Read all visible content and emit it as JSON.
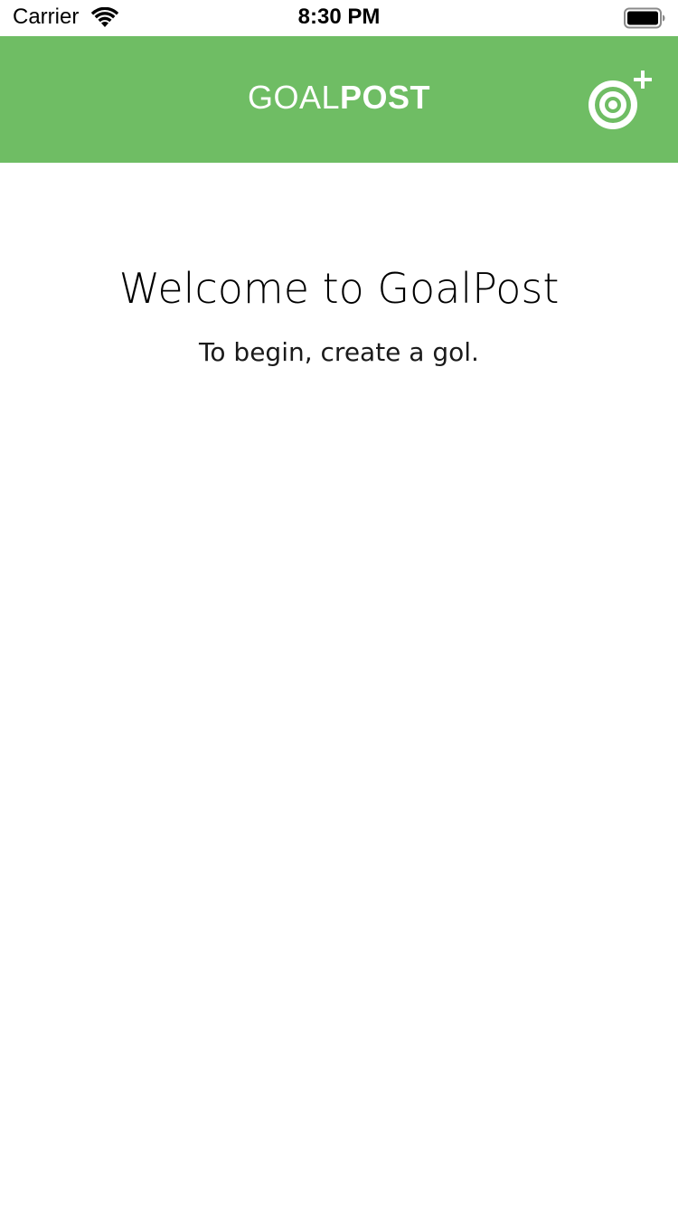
{
  "status_bar": {
    "carrier": "Carrier",
    "time": "8:30 PM",
    "wifi_icon": "wifi-icon",
    "battery_icon": "battery-icon"
  },
  "nav_bar": {
    "title_light": "GOAL",
    "title_bold": "POST",
    "add_goal_icon": "target-plus-icon",
    "background_color": "#6fbd64"
  },
  "content": {
    "welcome_title": "Welcome to GoalPost",
    "welcome_subtitle": "To begin, create a gol."
  }
}
